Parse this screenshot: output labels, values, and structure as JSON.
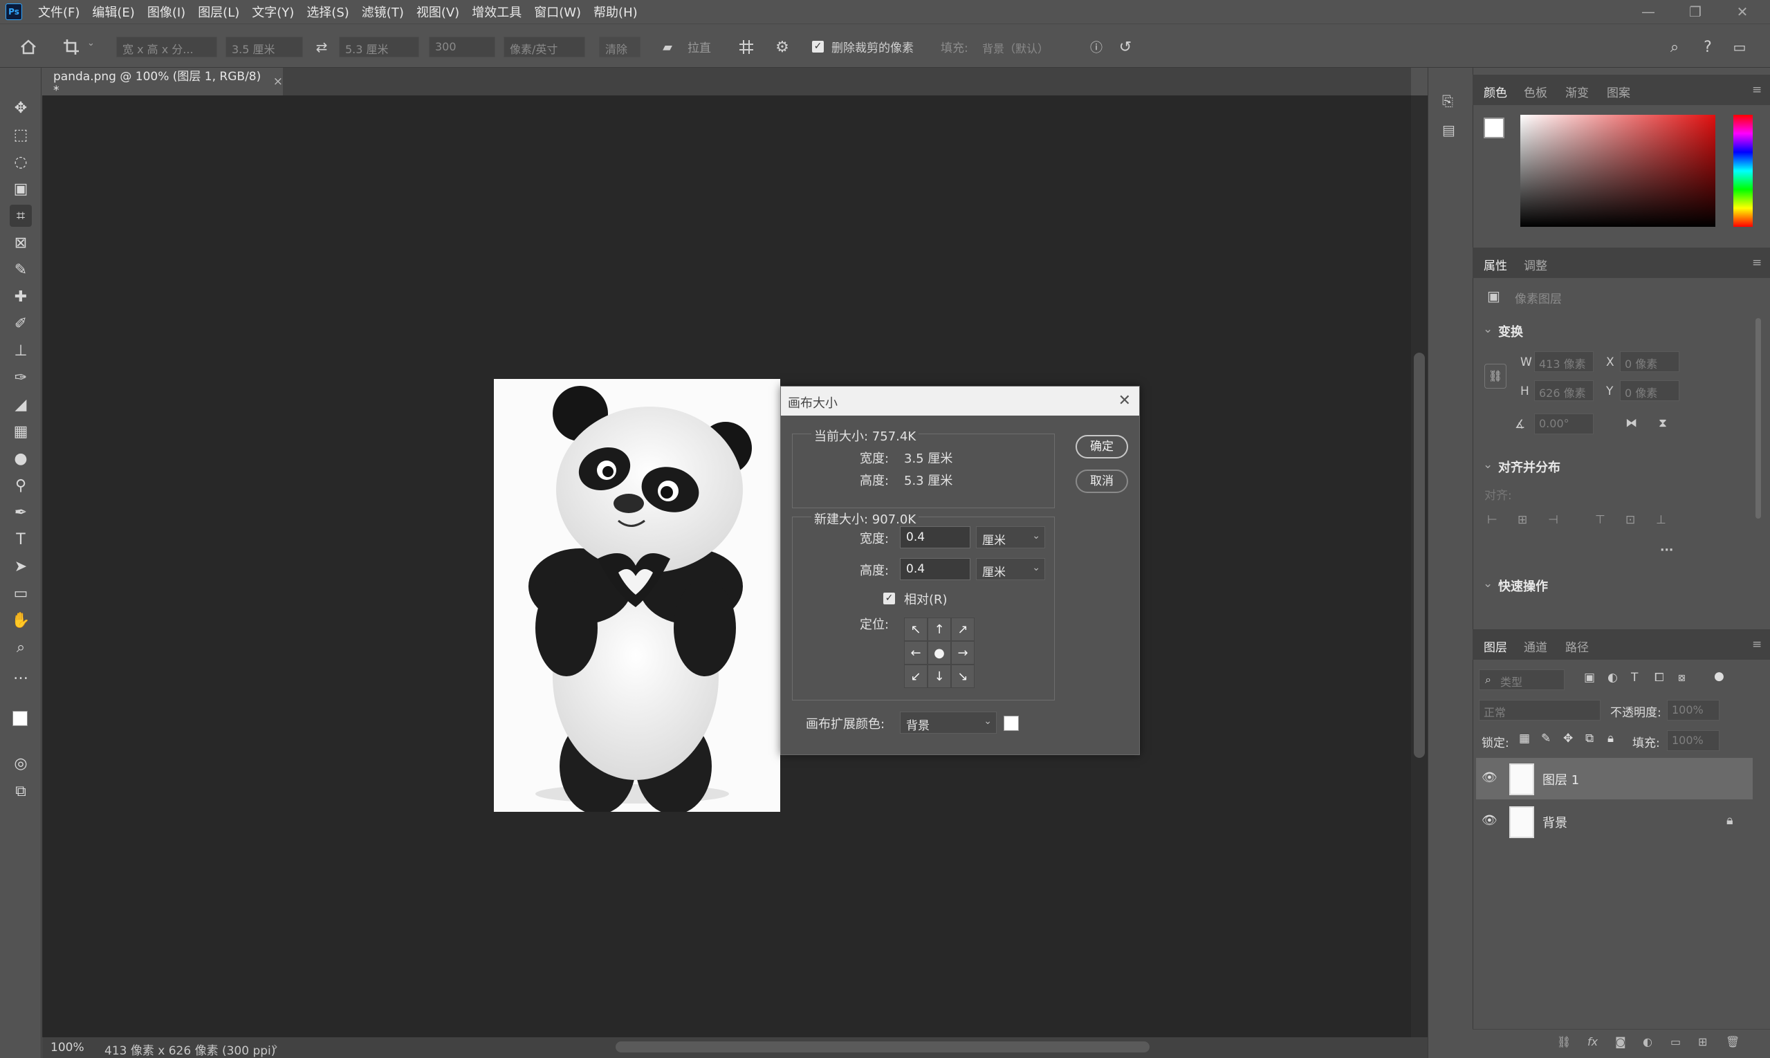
{
  "app": {
    "logo": "Ps"
  },
  "menu": [
    "文件(F)",
    "编辑(E)",
    "图像(I)",
    "图层(L)",
    "文字(Y)",
    "选择(S)",
    "滤镜(T)",
    "视图(V)",
    "增效工具",
    "窗口(W)",
    "帮助(H)"
  ],
  "options": {
    "ratio_select": "宽 x 高 x 分...",
    "width_value": "3.5 厘米",
    "height_value": "5.3 厘米",
    "resolution_value": "300",
    "unit_select": "像素/英寸",
    "clear_label": "清除",
    "straighten_label": "拉直",
    "delete_cropped_label": "删除裁剪的像素",
    "fill_label": "填充:",
    "fill_select": "背景（默认）"
  },
  "document": {
    "tab_title": "panda.png @ 100% (图层 1, RGB/8) *",
    "zoom": "100%",
    "status_info": "413 像素 x 626 像素 (300 ppi)"
  },
  "dialog": {
    "title": "画布大小",
    "current_size_label": "当前大小: 757.4K",
    "current_width_label": "宽度:",
    "current_width_value": "3.5 厘米",
    "current_height_label": "高度:",
    "current_height_value": "5.3 厘米",
    "new_size_label": "新建大小: 907.0K",
    "new_width_label": "宽度:",
    "new_width_value": "0.4",
    "new_width_unit": "厘米",
    "new_height_label": "高度:",
    "new_height_value": "0.4",
    "new_height_unit": "厘米",
    "relative_label": "相对(R)",
    "relative_checked": true,
    "anchor_label": "定位:",
    "extension_label": "画布扩展颜色:",
    "extension_value": "背景",
    "extension_color": "#ffffff",
    "ok_label": "确定",
    "cancel_label": "取消"
  },
  "color_panel": {
    "tabs": [
      "颜色",
      "色板",
      "渐变",
      "图案"
    ],
    "foreground": "#ffffff",
    "background": "#ffffff",
    "hue_color": "#e01010"
  },
  "properties_panel": {
    "tabs": [
      "属性",
      "调整"
    ],
    "layer_type": "像素图层",
    "transform_header": "变换",
    "w_label": "W",
    "w_value": "413 像素",
    "h_label": "H",
    "h_value": "626 像素",
    "x_label": "X",
    "x_value": "0 像素",
    "y_label": "Y",
    "y_value": "0 像素",
    "angle_value": "0.00°",
    "align_header": "对齐并分布",
    "align_label": "对齐:",
    "quick_header": "快速操作"
  },
  "layers_panel": {
    "tabs": [
      "图层",
      "通道",
      "路径"
    ],
    "search_placeholder": "类型",
    "blend_mode": "正常",
    "opacity_label": "不透明度:",
    "opacity_value": "100%",
    "lock_label": "锁定:",
    "fill_label": "填充:",
    "fill_value": "100%",
    "layers": [
      {
        "name": "图层 1",
        "selected": true,
        "locked": false
      },
      {
        "name": "背景",
        "selected": false,
        "locked": true
      }
    ]
  }
}
